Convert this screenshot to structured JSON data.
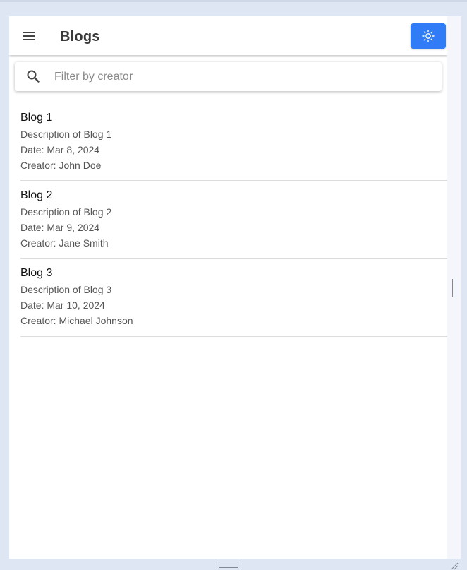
{
  "app": {
    "title": "Blogs",
    "menu_icon": "hamburger-menu-icon",
    "theme_icon": "sun-icon",
    "accent_color": "#2f7cf6"
  },
  "search": {
    "placeholder": "Filter by creator",
    "value": "",
    "icon": "search-icon"
  },
  "blogs": [
    {
      "title": "Blog 1",
      "description": "Description of Blog 1",
      "date": "Date: Mar 8, 2024",
      "creator": "Creator: John Doe"
    },
    {
      "title": "Blog 2",
      "description": "Description of Blog 2",
      "date": "Date: Mar 9, 2024",
      "creator": "Creator: Jane Smith"
    },
    {
      "title": "Blog 3",
      "description": "Description of Blog 3",
      "date": "Date: Mar 10, 2024",
      "creator": "Creator: Michael Johnson"
    }
  ]
}
